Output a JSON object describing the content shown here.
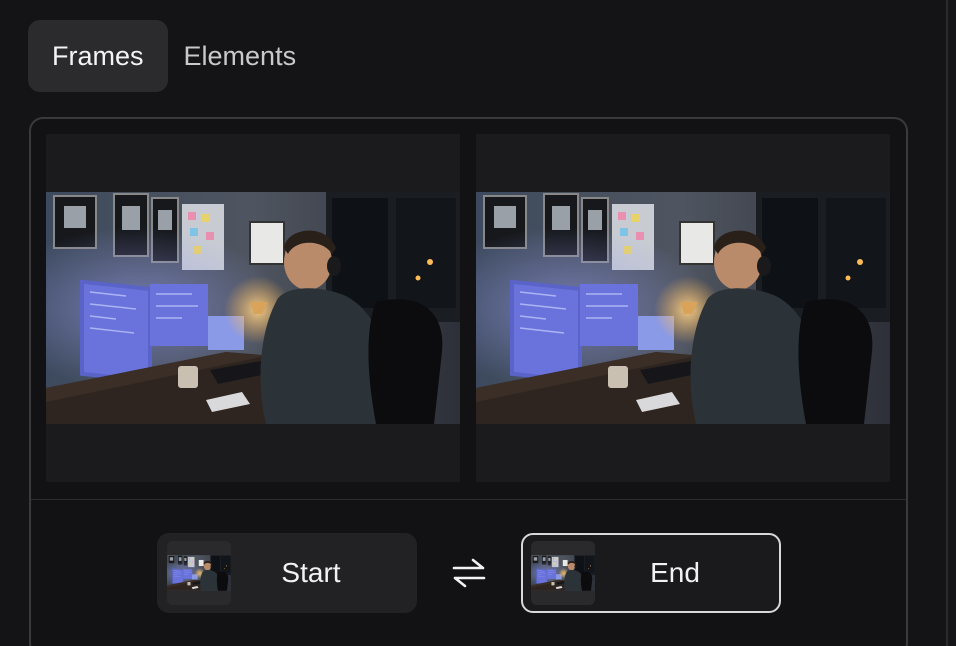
{
  "tabs": [
    {
      "label": "Frames",
      "active": true
    },
    {
      "label": "Elements",
      "active": false
    }
  ],
  "preview": {
    "frames": [
      {
        "image": "office-night-desk-scene",
        "icon": "image-icon"
      },
      {
        "image": "office-night-desk-scene",
        "icon": "image-icon"
      }
    ]
  },
  "controls": {
    "start_label": "Start",
    "end_label": "End",
    "swap_icon": "swap-arrows-icon",
    "selected": "End"
  },
  "colors": {
    "background": "#141416",
    "card_border": "#3a3a3e",
    "active_tab": "#2b2b2e",
    "selected_border": "#d8d8dc"
  }
}
